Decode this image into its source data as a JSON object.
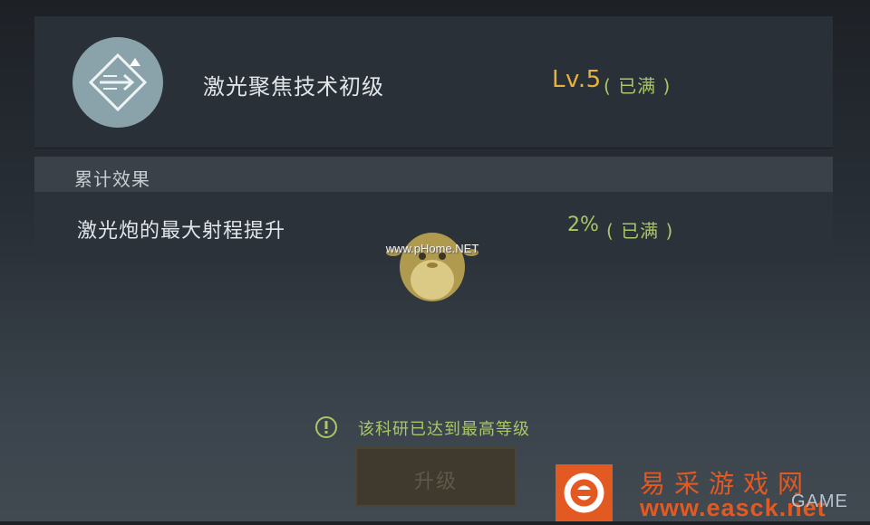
{
  "skill": {
    "name": "激光聚焦技术初级",
    "level": "Lv.5",
    "status": "( 已满 )",
    "icon": "laser-arrow-icon"
  },
  "effect": {
    "title": "累计效果",
    "name": "激光炮的最大射程提升",
    "value": "2%",
    "status": "( 已满 )"
  },
  "notice": {
    "text": "该科研已达到最高等级",
    "icon": "info-circle-icon"
  },
  "upgrade": {
    "label": "升级"
  },
  "watermarks": {
    "mascot_text": "www.pHome.NET",
    "brand_name": "易采游戏网",
    "brand_url": "www.easck.net",
    "brand_sub": "GAME"
  },
  "colors": {
    "level": "#e6b23c",
    "maxed": "#a9c768",
    "brand": "#e25922"
  }
}
